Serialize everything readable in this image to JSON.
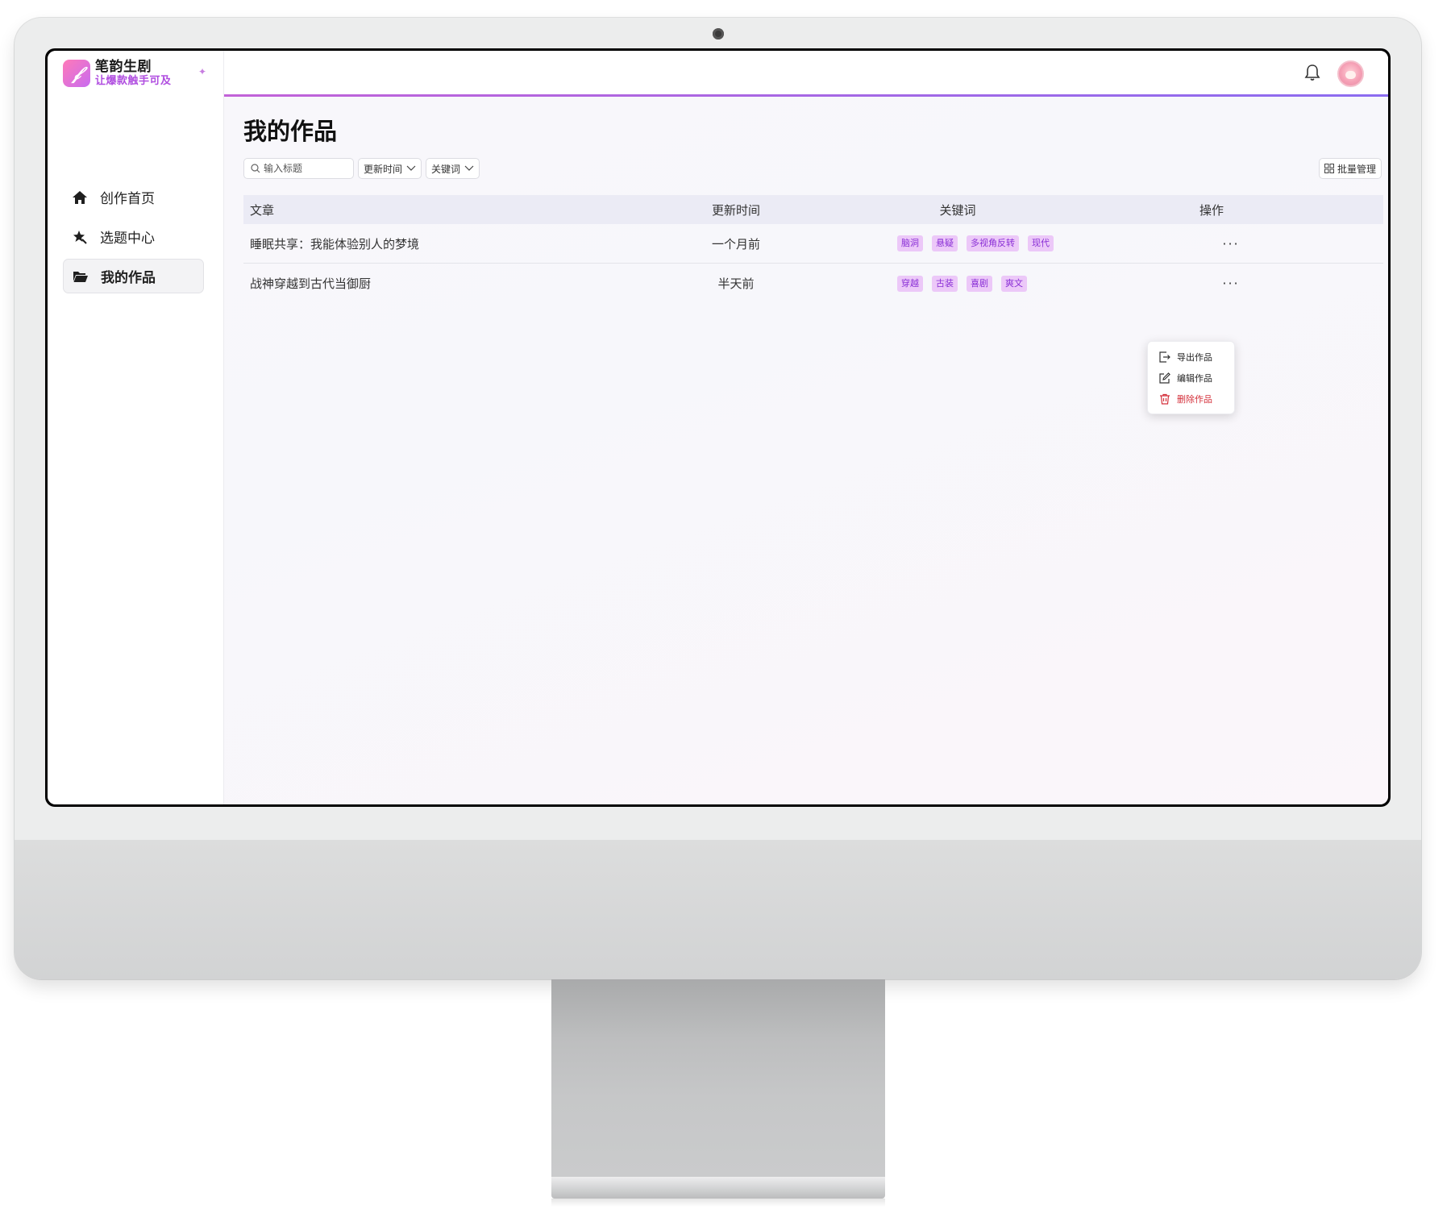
{
  "brand": {
    "name": "笔韵生剧",
    "slogan": "让爆款触手可及",
    "logo_glyph": "𝒻",
    "accent": "#b04ee0"
  },
  "sidebar": {
    "items": [
      {
        "label": "创作首页",
        "icon": "home-icon",
        "active": false
      },
      {
        "label": "选题中心",
        "icon": "star-pin-icon",
        "active": false
      },
      {
        "label": "我的作品",
        "icon": "folder-open-icon",
        "active": true
      }
    ]
  },
  "header": {
    "icons": [
      "bell-icon",
      "avatar"
    ]
  },
  "page": {
    "title": "我的作品"
  },
  "filters": {
    "search_placeholder": "输入标题",
    "sort_label": "更新时间",
    "keyword_label": "关键词",
    "batch_label": "批量管理"
  },
  "table": {
    "headers": {
      "title": "文章",
      "time": "更新时间",
      "keywords": "关键词",
      "actions": "操作"
    },
    "rows": [
      {
        "title": "睡眠共享：我能体验别人的梦境",
        "time": "一个月前",
        "tags": [
          "脑洞",
          "悬疑",
          "多视角反转",
          "现代"
        ],
        "more": "···"
      },
      {
        "title": "战神穿越到古代当御厨",
        "time": "半天前",
        "tags": [
          "穿越",
          "古装",
          "喜剧",
          "爽文"
        ],
        "more": "···"
      }
    ]
  },
  "context_menu": {
    "items": [
      {
        "label": "导出作品",
        "icon": "export-icon"
      },
      {
        "label": "编辑作品",
        "icon": "edit-icon"
      },
      {
        "label": "删除作品",
        "icon": "trash-icon",
        "danger": true
      }
    ]
  },
  "colors": {
    "tag_bg": "#ecc8f8",
    "tag_text": "#8a2fd6",
    "danger": "#d42f3a",
    "header_gradient": [
      "#c262d8",
      "#8b6cf0"
    ]
  }
}
